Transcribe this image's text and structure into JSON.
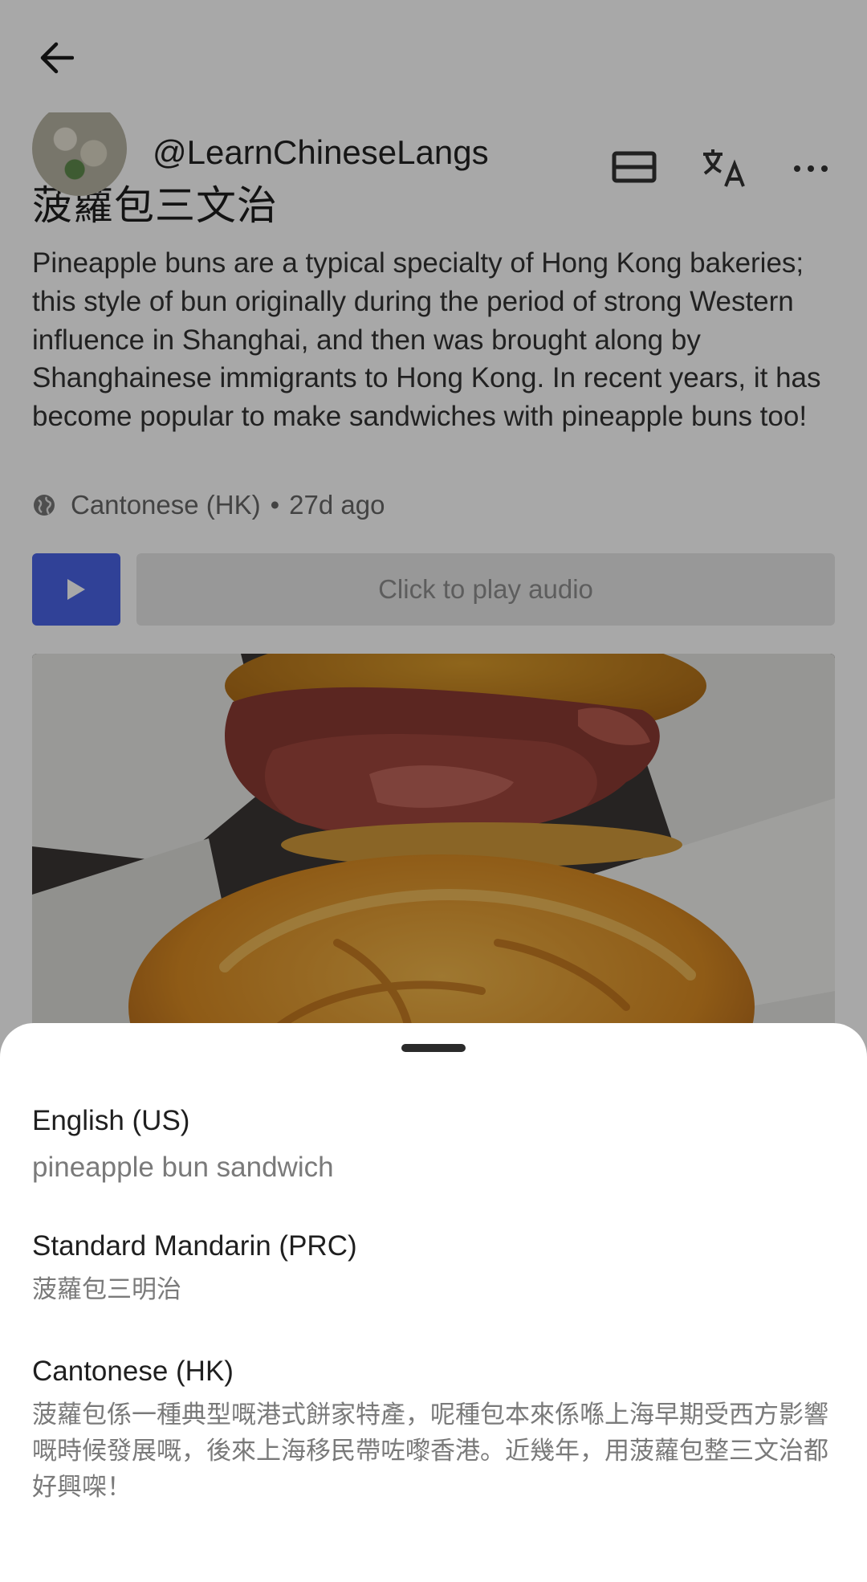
{
  "post": {
    "username": "@LearnChineseLangs",
    "title": "菠蘿包三文治",
    "body": "Pineapple buns are a typical specialty of Hong Kong bakeries; this style of bun originally during the period of strong Western influence in Shanghai, and then was brought along by Shanghainese immigrants to Hong Kong. In recent years, it has become popular to make sandwiches with pineapple buns too!",
    "language": "Cantonese (HK)",
    "separator": "•",
    "age": "27d ago",
    "audio_label": "Click to play audio"
  },
  "icons": {
    "back": "back-arrow-icon",
    "book": "book-icon",
    "translate": "translate-icon",
    "more": "more-icon",
    "globe": "globe-icon",
    "play": "play-icon"
  },
  "colors": {
    "accent": "#4a63e6",
    "scrim": "rgba(0,0,0,0.34)"
  },
  "translations": [
    {
      "language": "English (US)",
      "text": "pineapple bun sandwich"
    },
    {
      "language": "Standard Mandarin (PRC)",
      "text": "菠蘿包三明治"
    },
    {
      "language": "Cantonese (HK)",
      "text": "菠蘿包係一種典型嘅港式餅家特產，呢種包本來係喺上海早期受西方影響嘅時候發展嘅，後來上海移民帶咗嚟香港。近幾年，用菠蘿包整三文治都好興㗎！"
    }
  ]
}
